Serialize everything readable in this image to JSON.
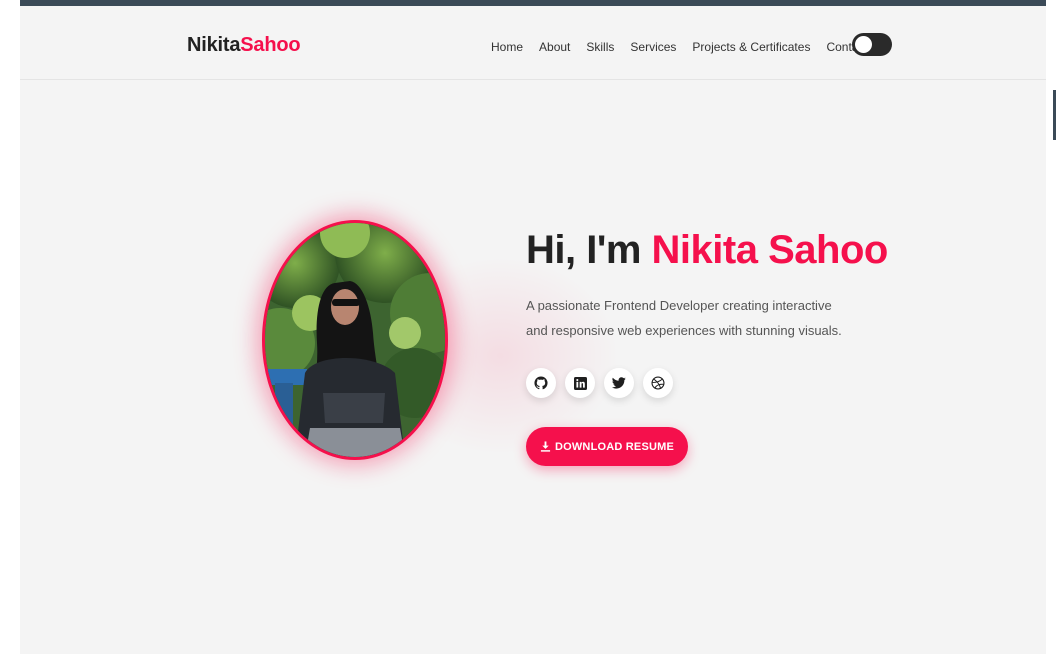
{
  "navbar": {
    "logo_first": "Nikita",
    "logo_second": "Sahoo",
    "links": [
      {
        "label": "Home"
      },
      {
        "label": "About"
      },
      {
        "label": "Skills"
      },
      {
        "label": "Services"
      },
      {
        "label": "Projects & Certificates"
      },
      {
        "label": "Contact"
      }
    ],
    "theme_toggle_icon": "moon-icon"
  },
  "hero": {
    "greeting": "Hi, I'm",
    "name": "Nikita Sahoo",
    "description": "A passionate Frontend Developer creating interactive and responsive web experiences with stunning visuals.",
    "socials": [
      {
        "icon": "github-icon"
      },
      {
        "icon": "linkedin-icon"
      },
      {
        "icon": "twitter-icon"
      },
      {
        "icon": "dribbble-icon"
      }
    ],
    "download_label": "DOWNLOAD RESUME",
    "download_icon": "download-icon"
  },
  "colors": {
    "accent": "#f5104c",
    "dark": "#222222",
    "background": "#f4f4f4"
  }
}
